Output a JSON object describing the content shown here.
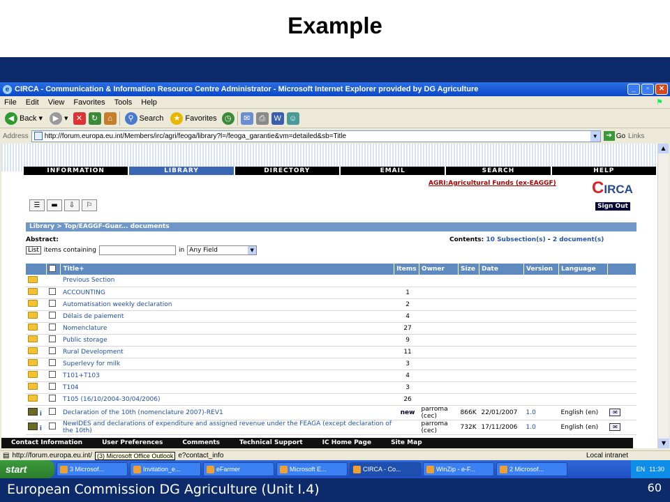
{
  "slide": {
    "title": "Example",
    "footer": "European Commission DG Agriculture (Unit I.4)",
    "page_number": "60"
  },
  "window": {
    "title": "CIRCA - Communication & Information Resource Centre Administrator - Microsoft Internet Explorer provided by DG Agriculture"
  },
  "menu": [
    "File",
    "Edit",
    "View",
    "Favorites",
    "Tools",
    "Help"
  ],
  "toolbar": {
    "back": "Back",
    "search": "Search",
    "favorites": "Favorites"
  },
  "address": {
    "label": "Address",
    "url": "http://forum.europa.eu.int/Members/irc/agri/feoga/library?l=/feoga_garantie&vm=detailed&sb=Title",
    "go": "Go",
    "links": "Links"
  },
  "nav": [
    "INFORMATION",
    "LIBRARY",
    "DIRECTORY",
    "EMAIL",
    "SEARCH",
    "HELP"
  ],
  "group_link": "AGRI:Agricultural Funds (ex-EAGGF)",
  "logo": "IRCA",
  "sign_out": "Sign Out",
  "breadcrumb": "Library > Top/EAGGF-Guar... documents",
  "abstract_label": "Abstract:",
  "contents": {
    "label": "Contents:",
    "subsections": "10 Subsection(s)",
    "sep": "-",
    "documents": "2 document(s)"
  },
  "filter": {
    "list_button": "List",
    "items_containing": "items containing",
    "in": "in",
    "field": "Any Field"
  },
  "table": {
    "headers": [
      "Title+",
      "Items",
      "Owner",
      "Size",
      "Date",
      "Version",
      "Language"
    ],
    "previous": "Previous Section",
    "folders": [
      {
        "title": "ACCOUNTING",
        "items": "1"
      },
      {
        "title": "Automatisation weekly declaration",
        "items": "2"
      },
      {
        "title": "Délais de paiement",
        "items": "4"
      },
      {
        "title": "Nomenclature",
        "items": "27"
      },
      {
        "title": "Public storage",
        "items": "9"
      },
      {
        "title": "Rural Development",
        "items": "11"
      },
      {
        "title": "Superlevy for milk",
        "items": "3"
      },
      {
        "title": "T101+T103",
        "items": "4"
      },
      {
        "title": "T104",
        "items": "3"
      },
      {
        "title": "T105 (16/10/2004-30/04/2006)",
        "items": "26"
      }
    ],
    "documents": [
      {
        "title": "Declaration of the 10th (nomenclature 2007)-REV1",
        "flag": "new",
        "owner": "parroma (cec)",
        "size": "866K",
        "date": "22/01/2007",
        "version": "1.0",
        "language": "English (en)"
      },
      {
        "title": "NewIDES and declarations of expenditure and assigned revenue under the FEAGA (except declaration of the 10th)",
        "flag": "",
        "owner": "parroma (cec)",
        "size": "732K",
        "date": "17/11/2006",
        "version": "1.0",
        "language": "English (en)"
      }
    ]
  },
  "bottom_nav": [
    "Contact Information",
    "User Preferences",
    "Comments",
    "Technical Support",
    "IC Home Page",
    "Site Map"
  ],
  "status": {
    "url_start": "http://forum.europa.eu.int/",
    "tooltip": "(3) Microsoft Office Outlook",
    "url_end": "e?contact_info",
    "zone": "Local intranet"
  },
  "taskbar": {
    "start": "start",
    "tasks": [
      "3 Microsof...",
      "Invitation_e...",
      "eFarmer",
      "Microsoft E...",
      "CIRCA - Co...",
      "WinZip - e-F...",
      "2 Microsof..."
    ],
    "lang": "EN",
    "time": "11:30"
  }
}
